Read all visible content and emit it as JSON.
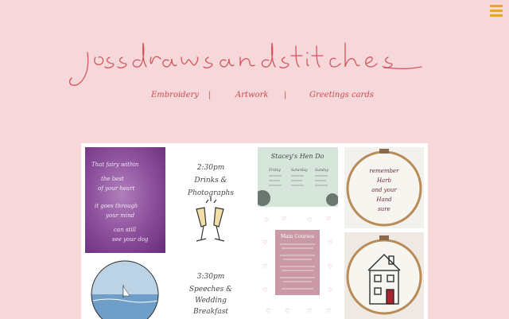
{
  "site": {
    "logo_text": "jessdrawsandstitches"
  },
  "nav": {
    "items": [
      {
        "label": "Embroidery"
      },
      {
        "label": "Artwork"
      },
      {
        "label": "Greetings cards"
      }
    ],
    "separator": "|"
  },
  "gallery": {
    "tiles": [
      {
        "name": "watercolor-quote-tile",
        "lines": [
          "That fairy within",
          "the best",
          "of your heart",
          "it goes through",
          "your mind",
          "can still",
          "see your dog"
        ]
      },
      {
        "name": "drinks-photographs-tile",
        "lines": [
          "2:30pm",
          "Drinks &",
          "Photographs"
        ]
      },
      {
        "name": "hen-do-tile",
        "title": "Stacey's Hen Do",
        "columns": [
          "Friday",
          "Saturday",
          "Sunday"
        ]
      },
      {
        "name": "remember-hoop-tile",
        "lines": [
          "remember",
          "Harb",
          "and your",
          "Hand",
          "sure"
        ]
      },
      {
        "name": "main-courses-menu-tile",
        "title": "Main Courses"
      },
      {
        "name": "house-hoop-tile"
      },
      {
        "name": "speeches-tile",
        "lines": [
          "3:30pm",
          "Speeches &",
          "Wedding",
          "Breakfast"
        ]
      },
      {
        "name": "seascape-circle-tile"
      }
    ]
  },
  "colors": {
    "background": "#f6d8da",
    "accent": "#c94a4f",
    "menu_icon": "#e9a23b"
  }
}
